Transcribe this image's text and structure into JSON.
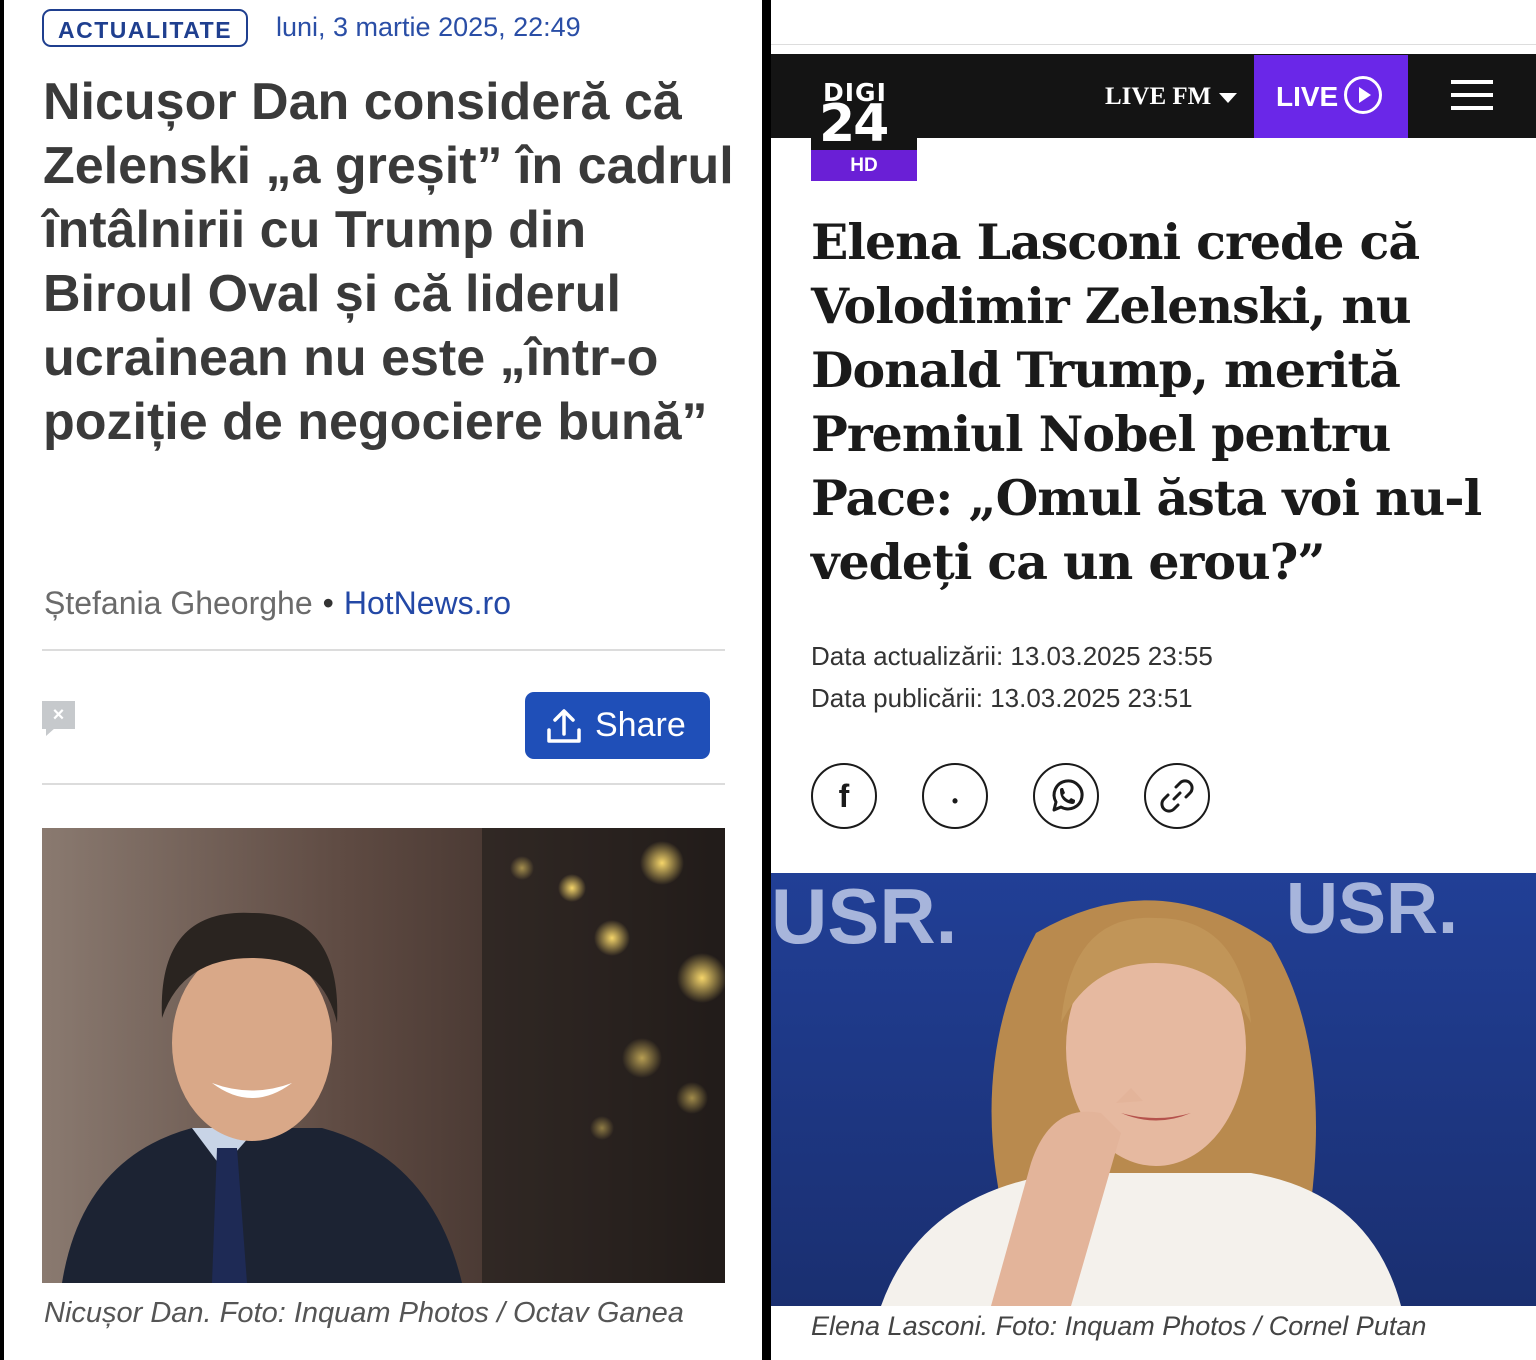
{
  "left": {
    "badge": "ACTUALITATE",
    "date": "luni, 3 martie 2025, 22:49",
    "title": "Nicușor Dan consideră că Zelenski „a greșit” în cadrul întâlnirii cu Trump din Biroul Oval și că liderul ucrainean nu este „într-o poziție de negociere bună”",
    "author": "Ștefania Gheorghe",
    "separator": "•",
    "source": "HotNews.ro",
    "share_label": "Share",
    "caption": "Nicușor Dan. Foto: Inquam Photos / Octav Ganea"
  },
  "right": {
    "nav": {
      "logo_top": "DIGI",
      "logo_number": "24",
      "logo_hd": "HD",
      "live_fm": "LIVE FM",
      "live": "LIVE"
    },
    "title": "Elena Lasconi crede că Volodimir Zelenski, nu Donald Trump, merită Premiul Nobel pentru Pace: „Omul ăsta voi nu-l vedeți ca un erou?”",
    "updated": "Data actualizării: 13.03.2025 23:55",
    "published": "Data publicării: 13.03.2025 23:51",
    "social": [
      {
        "icon": "facebook-icon",
        "glyph": "f"
      },
      {
        "icon": "twitter-icon",
        "glyph": "•"
      },
      {
        "icon": "whatsapp-icon",
        "glyph": ""
      },
      {
        "icon": "link-icon",
        "glyph": ""
      }
    ],
    "photo_text": "USR.",
    "caption": "Elena Lasconi. Foto: Inquam Photos / Cornel Putan"
  }
}
